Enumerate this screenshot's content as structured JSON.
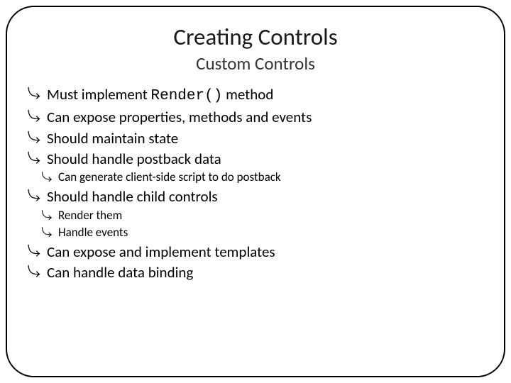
{
  "title": "Creating Controls",
  "subtitle": "Custom Controls",
  "bullets": {
    "b0_pre": "Must implement ",
    "b0_code": "Render()",
    "b0_post": " method",
    "b1": "Can expose properties, methods and events",
    "b2": "Should maintain state",
    "b3": "Should handle postback data",
    "b3_0": "Can generate client-side script to do postback",
    "b4": "Should handle child controls",
    "b4_0": "Render them",
    "b4_1": "Handle events",
    "b5": "Can expose and implement templates",
    "b6": "Can handle data binding"
  }
}
